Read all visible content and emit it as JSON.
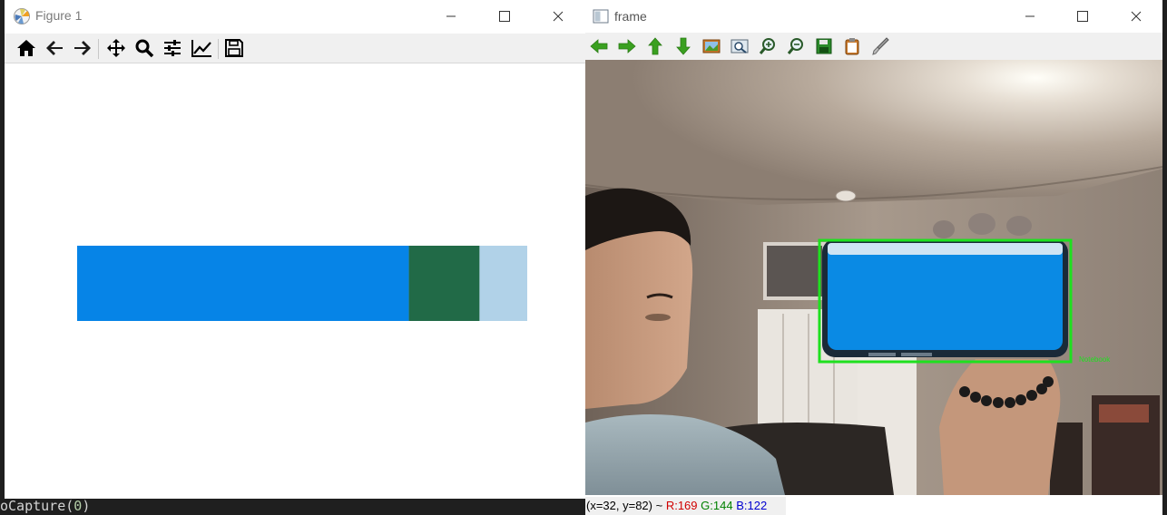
{
  "editor": {
    "code_prefix": "oCapture(",
    "code_arg": "0",
    "code_suffix": ")"
  },
  "figure_window": {
    "title": "Figure 1",
    "toolbar": [
      {
        "name": "home-icon"
      },
      {
        "name": "back-arrow-icon"
      },
      {
        "name": "forward-arrow-icon"
      },
      {
        "name": "pan-move-icon"
      },
      {
        "name": "zoom-magnifier-icon"
      },
      {
        "name": "configure-subplots-icon"
      },
      {
        "name": "edit-axes-icon"
      },
      {
        "name": "save-floppy-icon"
      }
    ]
  },
  "chart_data": {
    "type": "bar",
    "orientation": "horizontal-stacked",
    "segments": [
      {
        "fraction": 0.737,
        "color": "#0684e7"
      },
      {
        "fraction": 0.157,
        "color": "#216a47"
      },
      {
        "fraction": 0.106,
        "color": "#b1d2e8"
      }
    ],
    "axes": "off"
  },
  "frame_window": {
    "title": "frame",
    "toolbar": [
      {
        "name": "pan-left-icon"
      },
      {
        "name": "pan-right-icon"
      },
      {
        "name": "pan-up-icon"
      },
      {
        "name": "pan-down-icon"
      },
      {
        "name": "zoom-fit-image-icon"
      },
      {
        "name": "zoom-window-icon"
      },
      {
        "name": "zoom-in-icon"
      },
      {
        "name": "zoom-out-icon"
      },
      {
        "name": "save-image-icon"
      },
      {
        "name": "copy-clipboard-icon"
      },
      {
        "name": "properties-brush-icon"
      }
    ],
    "detection_label": "Notebook",
    "status": {
      "coords": "(x=32, y=82) ~",
      "r": "R:169",
      "g": "G:144",
      "b": "B:122"
    }
  },
  "colors": {
    "detection_box": "#1fe01f",
    "phone_screen": "#0a8ae4"
  }
}
